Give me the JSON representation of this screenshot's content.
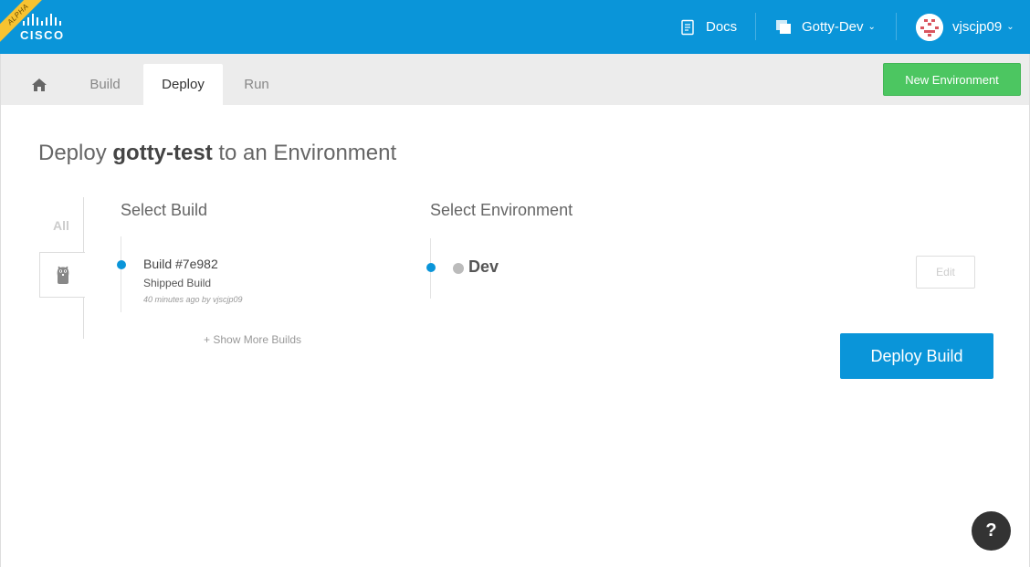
{
  "brand": {
    "ribbon": "ALPHA",
    "logo_text": "CISCO"
  },
  "nav": {
    "docs_label": "Docs",
    "project_label": "Gotty-Dev",
    "user_label": "vjscjp09",
    "caret": "⌄"
  },
  "tabs": {
    "items": [
      {
        "label": "Build"
      },
      {
        "label": "Deploy"
      },
      {
        "label": "Run"
      }
    ],
    "active": "Deploy",
    "new_environment_label": "New Environment"
  },
  "page": {
    "title_prefix": "Deploy ",
    "title_app": "gotty-test",
    "title_suffix": " to an Environment"
  },
  "filters": {
    "all_label": "All"
  },
  "builds": {
    "heading": "Select Build",
    "items": [
      {
        "title": "Build #7e982",
        "subtitle": "Shipped Build",
        "meta": "40 minutes ago by vjscjp09"
      }
    ],
    "show_more_label": "+ Show More Builds"
  },
  "environments": {
    "heading": "Select Environment",
    "items": [
      {
        "name": "Dev",
        "status_color": "#bbbbbb"
      }
    ],
    "edit_label": "Edit"
  },
  "actions": {
    "deploy_label": "Deploy Build",
    "help_label": "?"
  },
  "colors": {
    "brand_blue": "#0a95d9",
    "new_env_green": "#4cc661",
    "ribbon_yellow": "#f7c331"
  }
}
